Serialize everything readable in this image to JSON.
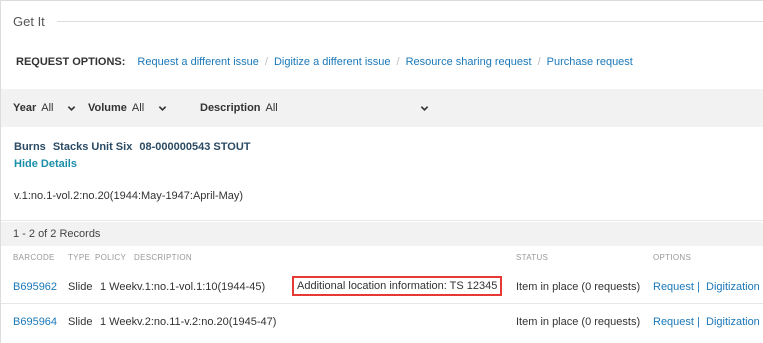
{
  "section": {
    "title": "Get It"
  },
  "request_options": {
    "label": "REQUEST OPTIONS:",
    "links": [
      "Request a different issue",
      "Digitize a different issue",
      "Resource sharing request",
      "Purchase request"
    ],
    "separator": "/"
  },
  "filters": {
    "year": {
      "label": "Year",
      "value": "All"
    },
    "volume": {
      "label": "Volume",
      "value": "All"
    },
    "description": {
      "label": "Description",
      "value": "All"
    }
  },
  "location": {
    "library": "Burns",
    "sublocation": "Stacks Unit Six",
    "call_number": "08-000000543 STOUT",
    "hide_details": "Hide Details",
    "summary": "v.1:no.1-vol.2:no.20(1944:May-1947:April-May)"
  },
  "records": {
    "count_text": "1 - 2 of 2 Records"
  },
  "columns": {
    "barcode": "BARCODE",
    "type": "TYPE",
    "policy": "POLICY",
    "description": "DESCRIPTION",
    "status": "STATUS",
    "options": "OPTIONS"
  },
  "items": [
    {
      "barcode": "B695962",
      "type": "Slide",
      "policy": "1 Week",
      "description": "v.1:no.1-vol.1:10(1944-45)",
      "note": "Additional location information: TS 12345",
      "status": "Item in place (0 requests)",
      "option_request": "Request",
      "option_sep": "|",
      "option_digitization": "Digitization"
    },
    {
      "barcode": "B695964",
      "type": "Slide",
      "policy": "1 Week",
      "description": "v.2:no.11-v.2:no.20(1945-47)",
      "status": "Item in place (0 requests)",
      "option_request": "Request",
      "option_sep": "|",
      "option_digitization": "Digitization"
    }
  ],
  "colors": {
    "link": "#1b78b9",
    "highlight_border": "#e53935",
    "bar_background": "#f2f2f2"
  },
  "icons": [
    "chevron-down-icon"
  ]
}
